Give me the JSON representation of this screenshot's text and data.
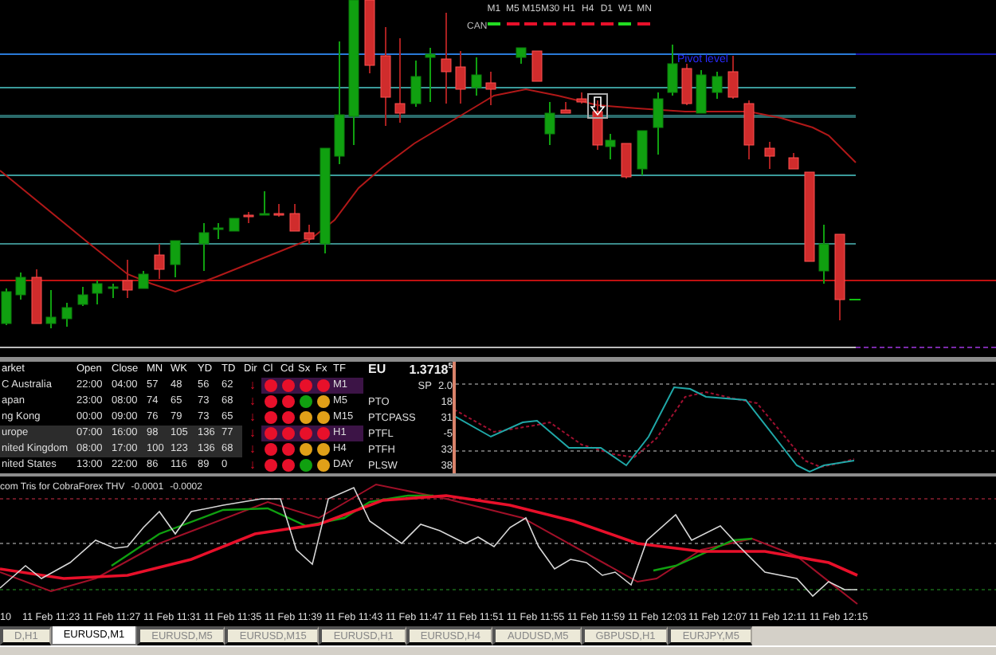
{
  "chart": {
    "timeframes": [
      {
        "label": "M1",
        "color": "#22dd22"
      },
      {
        "label": "M5",
        "color": "#e8102a"
      },
      {
        "label": "M15",
        "color": "#e8102a"
      },
      {
        "label": "M30",
        "color": "#e8102a"
      },
      {
        "label": "H1",
        "color": "#e8102a"
      },
      {
        "label": "H4",
        "color": "#e8102a"
      },
      {
        "label": "D1",
        "color": "#e8102a"
      },
      {
        "label": "W1",
        "color": "#22dd22"
      },
      {
        "label": "MN",
        "color": "#e8102a"
      }
    ],
    "signal_label": "CAN",
    "pivot_label": "Pivot level"
  },
  "market_table": {
    "columns": [
      "arket",
      "Open",
      "Close",
      "MN",
      "WK",
      "YD",
      "TD",
      "Dir",
      "Cl",
      "Cd",
      "Sx",
      "Fx",
      "TF"
    ],
    "rows": [
      {
        "market": "C Australia",
        "open": "22:00",
        "close": "04:00",
        "mn": "57",
        "wk": "48",
        "yd": "56",
        "td": "62",
        "dir": "↓",
        "signals": [
          {
            "color": "#e8102a"
          },
          {
            "color": "#e8102a"
          },
          {
            "color": "#e8102a"
          },
          {
            "color": "#e8102a"
          }
        ],
        "tf": "M1",
        "tf_selected": true,
        "active": false
      },
      {
        "market": "apan",
        "open": "23:00",
        "close": "08:00",
        "mn": "74",
        "wk": "65",
        "yd": "73",
        "td": "68",
        "dir": "↓",
        "signals": [
          {
            "color": "#e8102a"
          },
          {
            "color": "#e8102a"
          },
          {
            "color": "#10a010"
          },
          {
            "color": "#e0a018"
          }
        ],
        "tf": "M5",
        "tf_selected": false,
        "active": false
      },
      {
        "market": "ng Kong",
        "open": "00:00",
        "close": "09:00",
        "mn": "76",
        "wk": "79",
        "yd": "73",
        "td": "65",
        "dir": "↓",
        "signals": [
          {
            "color": "#e8102a"
          },
          {
            "color": "#e8102a"
          },
          {
            "color": "#e0a018"
          },
          {
            "color": "#e0a018"
          }
        ],
        "tf": "M15",
        "tf_selected": false,
        "active": false
      },
      {
        "market": "urope",
        "open": "07:00",
        "close": "16:00",
        "mn": "98",
        "wk": "105",
        "yd": "136",
        "td": "77",
        "dir": "↓",
        "signals": [
          {
            "color": "#e8102a"
          },
          {
            "color": "#e8102a"
          },
          {
            "color": "#e8102a"
          },
          {
            "color": "#e8102a"
          }
        ],
        "tf": "H1",
        "tf_selected": true,
        "active": true
      },
      {
        "market": "nited Kingdom",
        "open": "08:00",
        "close": "17:00",
        "mn": "100",
        "wk": "123",
        "yd": "136",
        "td": "68",
        "dir": "↓",
        "signals": [
          {
            "color": "#e8102a"
          },
          {
            "color": "#e8102a"
          },
          {
            "color": "#e0a018"
          },
          {
            "color": "#e0a018"
          }
        ],
        "tf": "H4",
        "tf_selected": false,
        "active": true
      },
      {
        "market": "nited States",
        "open": "13:00",
        "close": "22:00",
        "mn": "86",
        "wk": "116",
        "yd": "89",
        "td": "0",
        "dir": "↓",
        "signals": [
          {
            "color": "#e8102a"
          },
          {
            "color": "#e8102a"
          },
          {
            "color": "#10a010"
          },
          {
            "color": "#e0a018"
          }
        ],
        "tf": "DAY",
        "tf_selected": false,
        "active": false
      }
    ]
  },
  "quote": {
    "symbol": "EU",
    "price": "1.3718$^{5}$",
    "spread_label": "SP",
    "spread": "2.0",
    "stats": [
      {
        "label": "PTO",
        "value": "18"
      },
      {
        "label": "PTCPASS",
        "value": "31"
      },
      {
        "label": "PTFL",
        "value": "-5"
      },
      {
        "label": "PTFH",
        "value": "33"
      },
      {
        "label": "PLSW",
        "value": "38"
      }
    ]
  },
  "indicator": {
    "name": "com Tris for CobraForex THV",
    "values": [
      "-0.0001",
      "-0.0002"
    ]
  },
  "time_axis": [
    "10",
    "11 Feb 11:23",
    "11 Feb 11:27",
    "11 Feb 11:31",
    "11 Feb 11:35",
    "11 Feb 11:39",
    "11 Feb 11:43",
    "11 Feb 11:47",
    "11 Feb 11:51",
    "11 Feb 11:55",
    "11 Feb 11:59",
    "11 Feb 12:03",
    "11 Feb 12:07",
    "11 Feb 12:11",
    "11 Feb 12:15"
  ],
  "tabs": [
    {
      "label": "D,H1",
      "selected": false
    },
    {
      "label": "EURUSD,M1",
      "selected": true
    },
    {
      "label": "EURUSD,M5",
      "selected": false
    },
    {
      "label": "EURUSD,M15",
      "selected": false
    },
    {
      "label": "EURUSD,H1",
      "selected": false
    },
    {
      "label": "EURUSD,H4",
      "selected": false
    },
    {
      "label": "AUDUSD,M5",
      "selected": false
    },
    {
      "label": "GBPUSD,H1",
      "selected": false
    },
    {
      "label": "EURJPY,M5",
      "selected": false
    }
  ]
}
